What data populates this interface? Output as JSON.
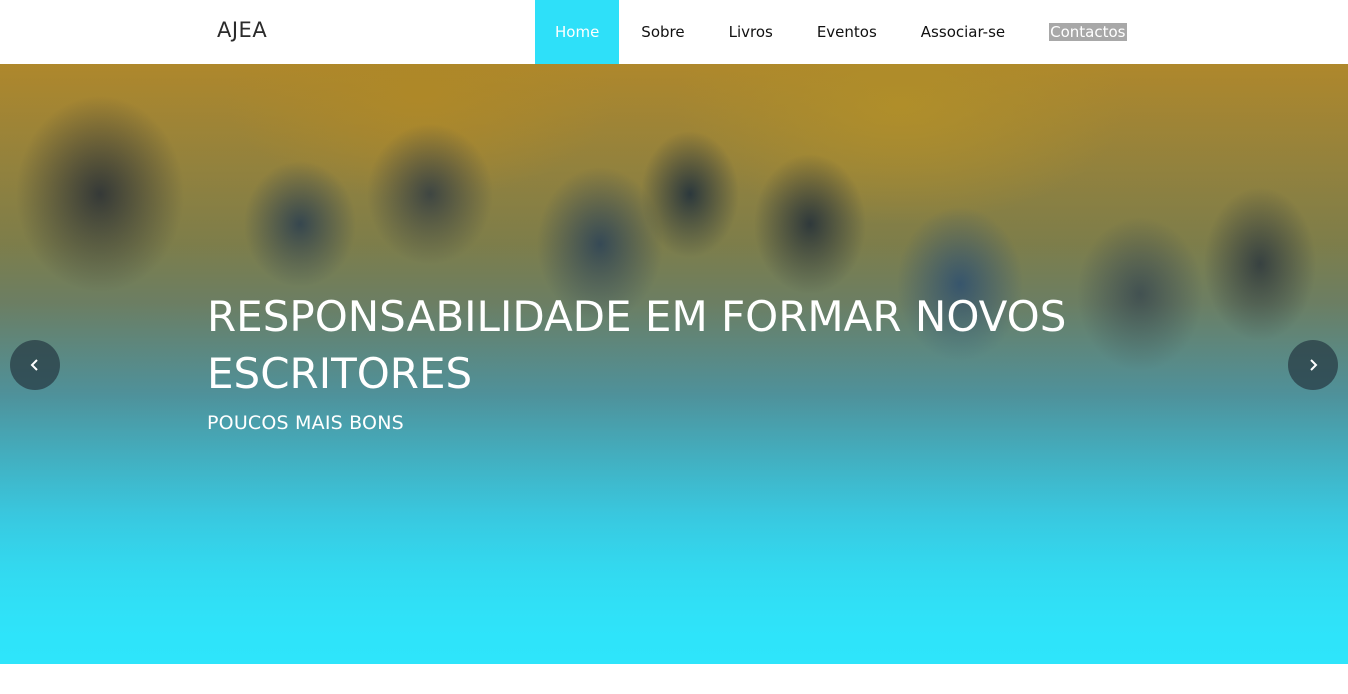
{
  "header": {
    "brand": "AJEA",
    "nav": [
      {
        "label": "Home",
        "state": "active"
      },
      {
        "label": "Sobre",
        "state": "normal"
      },
      {
        "label": "Livros",
        "state": "normal"
      },
      {
        "label": "Eventos",
        "state": "normal"
      },
      {
        "label": "Associar-se",
        "state": "normal"
      },
      {
        "label": "Contactos",
        "state": "selected"
      }
    ]
  },
  "hero": {
    "title": "RESPONSABILIDADE EM FORMAR NOVOS ESCRITORES",
    "subtitle": "POUCOS MAIS BONS",
    "prev_icon": "chevron-left-icon",
    "next_icon": "chevron-right-icon"
  },
  "colors": {
    "accent": "#2ee0f9",
    "nav_text": "#111111",
    "selection_highlight": "#a8a8a8"
  }
}
